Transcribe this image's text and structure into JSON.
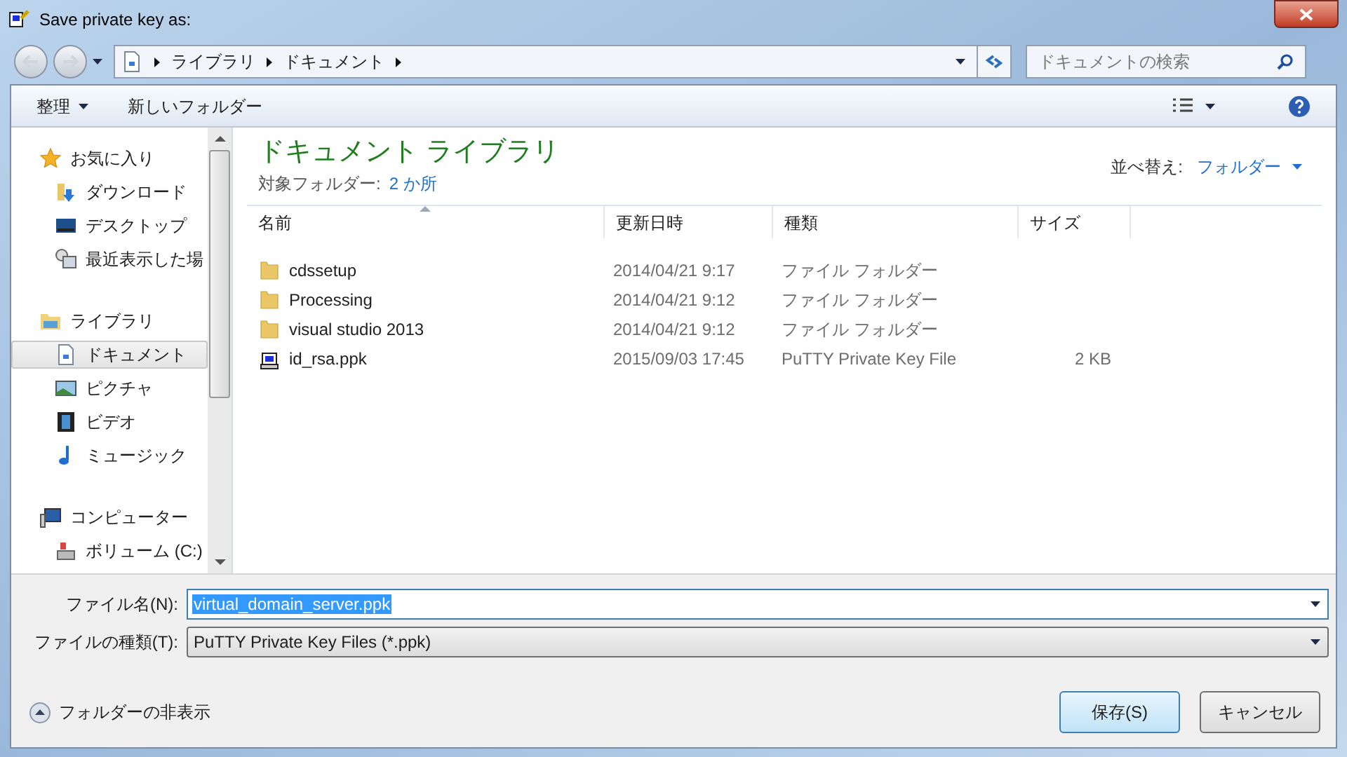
{
  "window": {
    "title": "Save private key as:"
  },
  "address_bar": {
    "path": [
      "ライブラリ",
      "ドキュメント"
    ]
  },
  "search": {
    "placeholder": "ドキュメントの検索"
  },
  "toolbar": {
    "organize": "整理",
    "new_folder": "新しいフォルダー"
  },
  "sidebar": {
    "groups": [
      {
        "label": "お気に入り",
        "children": [
          {
            "label": "ダウンロード",
            "selected": false
          },
          {
            "label": "デスクトップ",
            "selected": false
          },
          {
            "label": "最近表示した場",
            "selected": false
          }
        ]
      },
      {
        "label": "ライブラリ",
        "children": [
          {
            "label": "ドキュメント",
            "selected": true
          },
          {
            "label": "ピクチャ",
            "selected": false
          },
          {
            "label": "ビデオ",
            "selected": false
          },
          {
            "label": "ミュージック",
            "selected": false
          }
        ]
      },
      {
        "label": "コンピューター",
        "children": [
          {
            "label": "ボリューム (C:)",
            "selected": false
          }
        ]
      }
    ]
  },
  "library": {
    "title": "ドキュメント ライブラリ",
    "folders_label": "対象フォルダー:",
    "folders_link": "2 か所",
    "sort_label": "並べ替え:",
    "sort_value": "フォルダー"
  },
  "table": {
    "columns": [
      {
        "label": "名前",
        "sorted": true
      },
      {
        "label": "更新日時",
        "sorted": false
      },
      {
        "label": "種類",
        "sorted": false
      },
      {
        "label": "サイズ",
        "sorted": false
      }
    ],
    "rows": [
      {
        "kind": "folder",
        "name": "cdssetup",
        "date": "2014/04/21 9:17",
        "type": "ファイル フォルダー"
      },
      {
        "kind": "folder",
        "name": "Processing",
        "date": "2014/04/21 9:12",
        "type": "ファイル フォルダー"
      },
      {
        "kind": "folder",
        "name": "visual studio 2013",
        "date": "2014/04/21 9:12",
        "type": "ファイル フォルダー"
      },
      {
        "kind": "key",
        "name": "id_rsa.ppk",
        "date": "2015/09/03 17:45",
        "type": "PuTTY Private Key File",
        "size": "2 KB"
      }
    ]
  },
  "filename": {
    "label": "ファイル名(N):",
    "value": "virtual_domain_server.ppk"
  },
  "filetype": {
    "label": "ファイルの種類(T):",
    "value": "PuTTY Private Key Files (*.ppk)"
  },
  "hide_folders": "フォルダーの非表示",
  "buttons": [
    {
      "label": "保存(S)",
      "default": true
    },
    {
      "label": "キャンセル",
      "default": false
    }
  ]
}
